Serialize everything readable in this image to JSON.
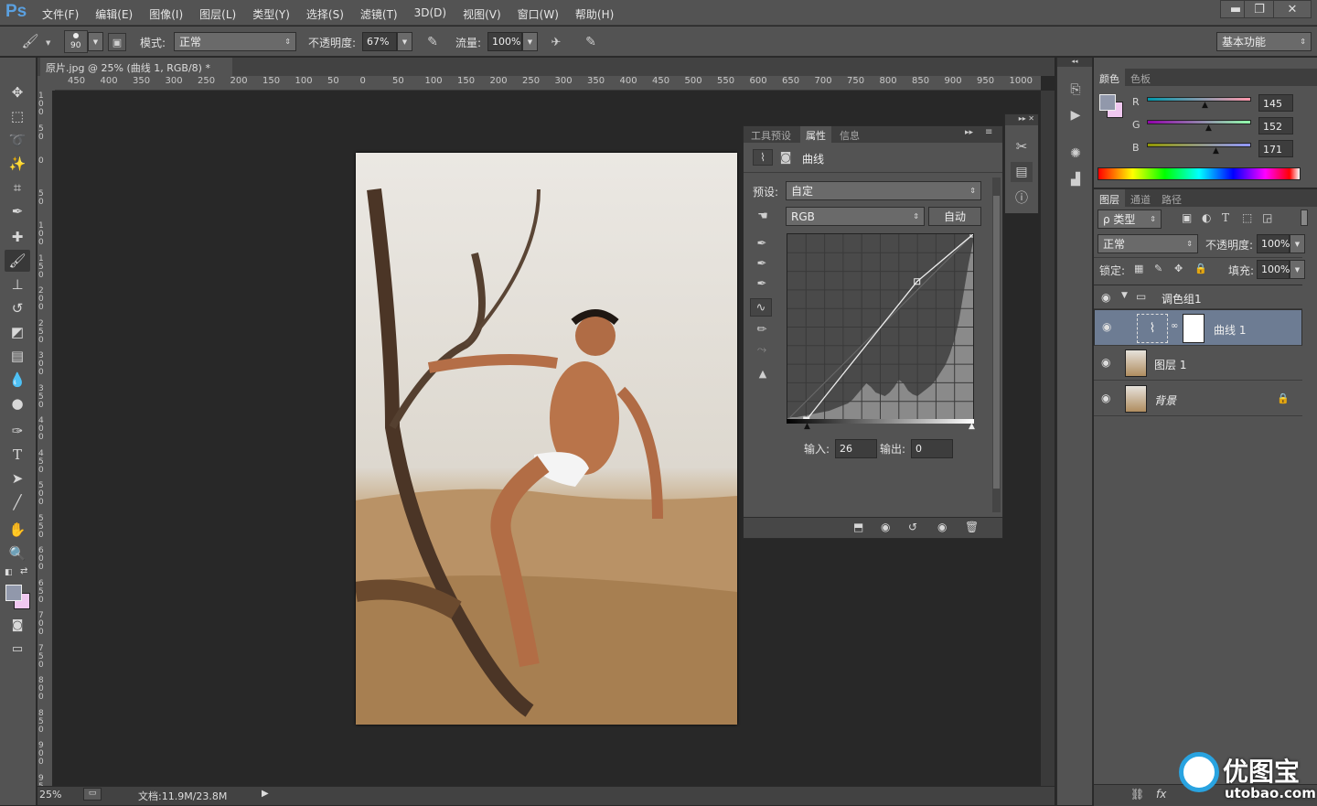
{
  "menubar": {
    "logo": "Ps",
    "items": [
      "文件(F)",
      "编辑(E)",
      "图像(I)",
      "图层(L)",
      "类型(Y)",
      "选择(S)",
      "滤镜(T)",
      "3D(D)",
      "视图(V)",
      "窗口(W)",
      "帮助(H)"
    ],
    "win_min": "▬",
    "win_restore": "❐",
    "win_close": "✕"
  },
  "options": {
    "brush_size": "90",
    "mode_label": "模式:",
    "mode_value": "正常",
    "opacity_label": "不透明度:",
    "opacity_value": "67%",
    "flow_label": "流量:",
    "flow_value": "100%",
    "workspace": "基本功能"
  },
  "document": {
    "tab_title": "原片.jpg @ 25% (曲线 1, RGB/8) *",
    "tab_close": "×",
    "ruler_h": [
      "450",
      "400",
      "350",
      "300",
      "250",
      "200",
      "150",
      "100",
      "50",
      "0",
      "50",
      "100",
      "150",
      "200",
      "250",
      "300",
      "350",
      "400",
      "450",
      "500",
      "550",
      "600",
      "650",
      "700",
      "750",
      "800",
      "850",
      "900",
      "950",
      "1000"
    ],
    "ruler_v": [
      "1 0 0",
      "5 0",
      "0",
      "5 0",
      "1 0 0",
      "1 5 0",
      "2 0 0",
      "2 5 0",
      "3 0 0",
      "3 5 0",
      "4 0 0",
      "4 5 0",
      "5 0 0",
      "5 5 0",
      "6 0 0",
      "6 5 0",
      "7 0 0",
      "7 5 0",
      "8 0 0",
      "8 5 0",
      "9 0 0",
      "9 5 0"
    ],
    "zoom": "25%",
    "doc_size": "文档:11.9M/23.8M"
  },
  "properties": {
    "tabs": [
      "工具预设",
      "属性",
      "信息"
    ],
    "active_tab": "属性",
    "panel_title": "曲线",
    "preset_label": "预设:",
    "preset_value": "自定",
    "channel_value": "RGB",
    "auto_button": "自动",
    "input_label": "输入:",
    "input_value": "26",
    "output_label": "输出:",
    "output_value": "0"
  },
  "curve": {
    "input": 26,
    "output": 0,
    "points": [
      [
        26,
        0
      ],
      [
        178,
        190
      ],
      [
        255,
        255
      ]
    ]
  },
  "color_panel": {
    "tabs": [
      "颜色",
      "色板"
    ],
    "r_label": "R",
    "r_value": "145",
    "g_label": "G",
    "g_value": "152",
    "b_label": "B",
    "b_value": "171",
    "fg_color": "#9198ab",
    "bg_color": "#f0c8f0"
  },
  "layers_panel": {
    "tabs": [
      "图层",
      "通道",
      "路径"
    ],
    "filter_kind": "ρ 类型",
    "blend_mode": "正常",
    "opacity_label": "不透明度:",
    "opacity_value": "100%",
    "lock_label": "锁定:",
    "fill_label": "填充:",
    "fill_value": "100%",
    "layers": [
      {
        "name": "调色组1",
        "type": "group"
      },
      {
        "name": "曲线 1",
        "type": "adjustment",
        "selected": true
      },
      {
        "name": "图层 1",
        "type": "pixel"
      },
      {
        "name": "背景",
        "type": "background"
      }
    ]
  },
  "watermark": {
    "text": "优图宝",
    "url": "utobao.com"
  }
}
